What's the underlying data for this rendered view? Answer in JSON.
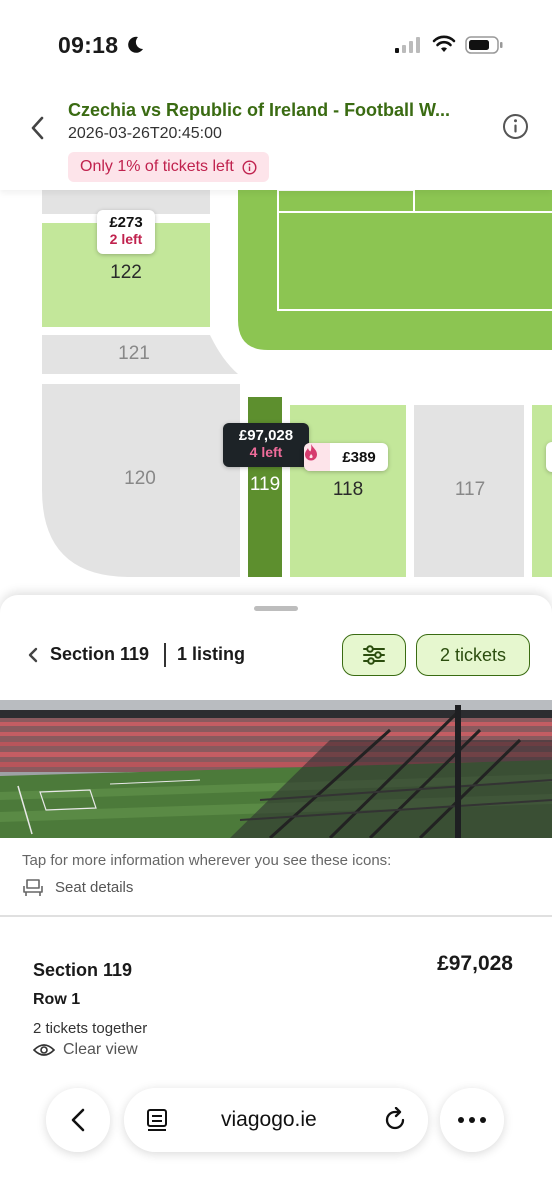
{
  "status_bar": {
    "time": "09:18"
  },
  "header": {
    "title": "Czechia vs Republic of Ireland - Football W...",
    "date": "2026-03-26T20:45:00",
    "scarcity": "Only 1% of tickets left"
  },
  "map": {
    "sections": [
      {
        "id": "122",
        "state": "available"
      },
      {
        "id": "121",
        "state": "unavailable"
      },
      {
        "id": "120",
        "state": "unavailable"
      },
      {
        "id": "119",
        "state": "selected"
      },
      {
        "id": "118",
        "state": "available"
      },
      {
        "id": "117",
        "state": "unavailable"
      }
    ],
    "tooltips": {
      "s122": {
        "price": "£273",
        "left": "2 left"
      },
      "s119": {
        "price": "£97,028",
        "left": "4 left"
      },
      "s118": {
        "price": "£389"
      }
    }
  },
  "sheet": {
    "section_title": "Section 119",
    "listing_count": "1 listing",
    "tickets_button": "2 tickets",
    "info_text": "Tap for more information wherever you see these icons:",
    "seat_details": "Seat details",
    "listing": {
      "section": "Section 119",
      "price": "£97,028",
      "row": "Row 1",
      "together": "2 tickets together",
      "feature": "Clear view"
    }
  },
  "browser": {
    "url": "viagogo.ie"
  },
  "colors": {
    "available": "#c3e79a",
    "selected": "#5d8f2e",
    "unavailable": "#e3e3e3",
    "pitch": "#8cc552",
    "brand": "#3a6b12",
    "alert": "#c0224e"
  }
}
